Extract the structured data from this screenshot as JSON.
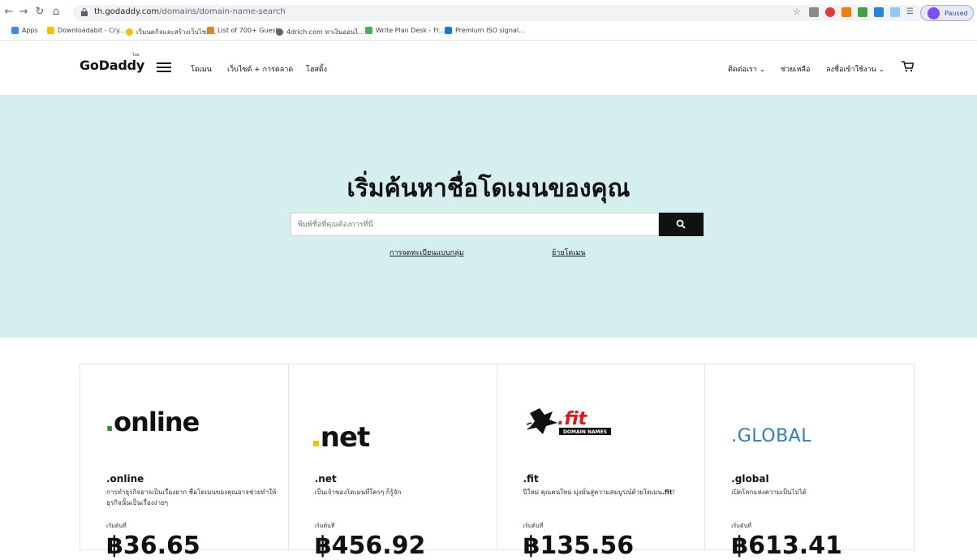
{
  "browser": {
    "url_host": "th.godaddy.com",
    "url_path": "/domains/domain-name-search",
    "profile_status": "Paused",
    "nav_icons": [
      "back-icon",
      "forward-icon",
      "reload-icon",
      "home-icon"
    ]
  },
  "bookmarks": [
    {
      "label": "Apps",
      "color": "#4285f4"
    },
    {
      "label": "Downloadabit - Cry...",
      "color": "#f2c200"
    },
    {
      "label": "เริ่มนตกิจและสร้างเว็บไซต์...",
      "color": "#f2c200"
    },
    {
      "label": "List of 700+ Guest...",
      "color": "#e67e22"
    },
    {
      "label": "4drich.com หาเงินออนไ...",
      "color": "#5f6368"
    },
    {
      "label": "Write Plan Desk - Fr...",
      "color": "#4caf50"
    },
    {
      "label": "Premium ISO signal...",
      "color": "#1a73e8"
    }
  ],
  "header": {
    "logo": "GoDaddy",
    "logo_sub": "ไทย",
    "nav": [
      "โดเมน",
      "เว็บไซต์ + การตลาด",
      "โฮสติ้ง"
    ],
    "right": [
      "ติดต่อเรา ⌄",
      "ช่วยเหลือ",
      "ลงชื่อเข้าใช้งาน ⌄"
    ]
  },
  "hero": {
    "title": "เริ่มค้นหาชื่อโดเมนของคุณ",
    "search_placeholder": "พิมพ์ชื่อที่คุณต้องการที่นี่",
    "links": [
      "การจดทะเบียนแบบกลุ่ม",
      "ย้ายโดเมน"
    ],
    "bg_color": "#d4efed"
  },
  "cards": [
    {
      "name": ".online",
      "desc": "การทำธุรกิจอาจเป็นเรื่องยาก ชื่อโดเมนของคุณอาจช่วยทำให้ธุรกิจนั้นเป็นเรื่องง่ายๆ",
      "from": "เริ่มต้นที่",
      "price": "฿36.65",
      "logo_text": "online"
    },
    {
      "name": ".net",
      "desc": "เป็นเจ้าของโดเมนที่ใครๆ ก็รู้จัก",
      "from": "เริ่มต้นที่",
      "price": "฿456.92",
      "logo_text": "net"
    },
    {
      "name": ".fit",
      "desc_pre": "ปีใหม่ คุณคนใหม่ มุ่งมั่นสู่ความสมบูรณ์ด้วยโดเมน",
      "desc_bold": ".fit",
      "desc_post": "!",
      "from": "เริ่มต้นที่",
      "price": "฿135.56",
      "logo_text": ".fit",
      "logo_sub": "DOMAIN NAMES"
    },
    {
      "name": ".global",
      "desc": "เปิดโลกแห่งความเป็นไปได้",
      "from": "เริ่มต้นที่",
      "price": "฿613.41",
      "logo_text": ".GLOBAL"
    }
  ]
}
